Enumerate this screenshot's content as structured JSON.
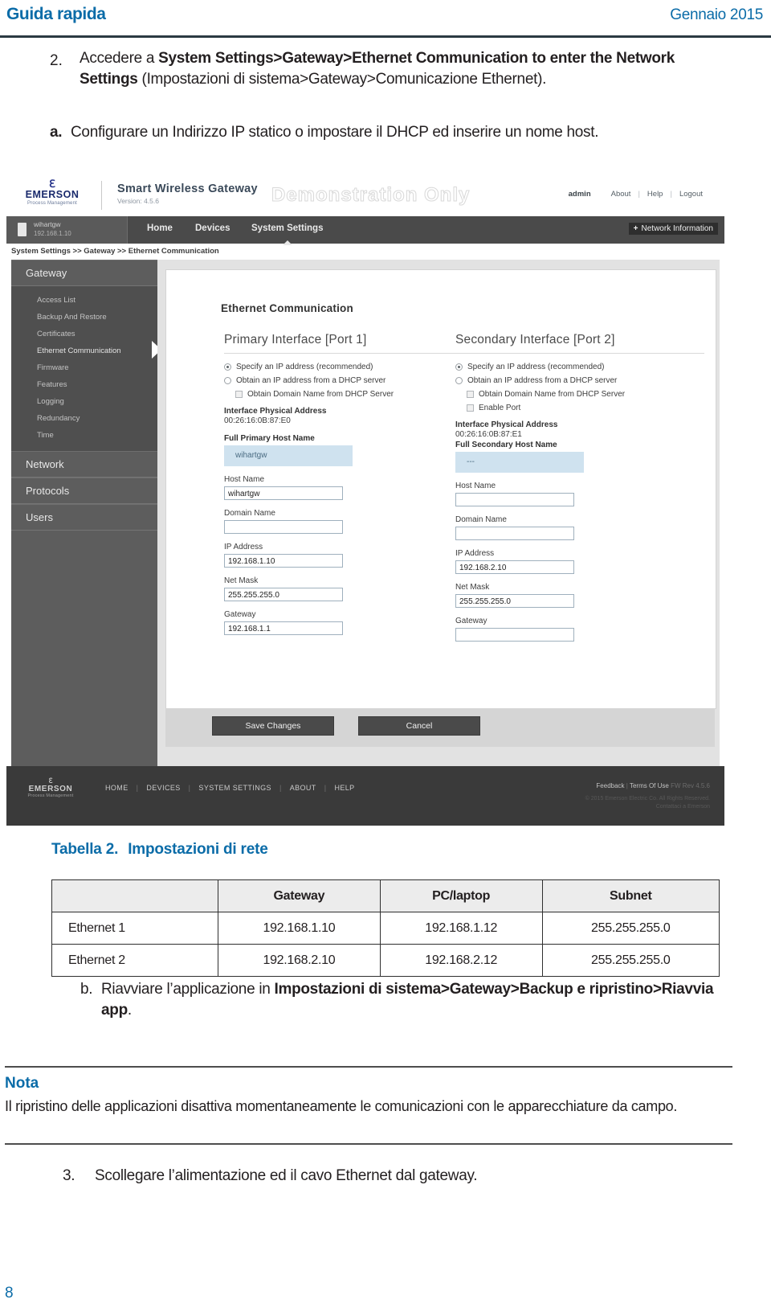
{
  "page": {
    "header_title": "Guida rapida",
    "header_date": "Gennaio 2015",
    "page_number": "8"
  },
  "step2": {
    "number": "2.",
    "text_part1": "Accedere a ",
    "bold1": "System Settings>Gateway>Ethernet Communication to enter the Network Settings",
    "text_part2": " (Impostazioni di sistema>Gateway>Comunicazione Ethernet).",
    "sub_a_label": "a.",
    "sub_a_text": "Configurare un Indirizzo IP statico o impostare il DHCP ed inserire un nome host."
  },
  "screenshot": {
    "brand": {
      "mark": "ℇ",
      "name": "EMERSON",
      "tagline": "Process Management"
    },
    "product": {
      "name": "Smart Wireless Gateway",
      "version": "Version: 4.5.6"
    },
    "watermark": "Demonstration Only",
    "topnav_right": {
      "user": "admin",
      "about": "About",
      "help": "Help",
      "logout": "Logout"
    },
    "device": {
      "name": "wihartgw",
      "ip": "192.168.1.10"
    },
    "nav": [
      "Home",
      "Devices",
      "System Settings"
    ],
    "nav_active": "System Settings",
    "network_information": "Network Information",
    "breadcrumb": "System Settings >> Gateway >> Ethernet Communication",
    "sidebar": {
      "sections": [
        {
          "label": "Gateway",
          "items": [
            "Access List",
            "Backup And Restore",
            "Certificates",
            "Ethernet Communication",
            "Firmware",
            "Features",
            "Logging",
            "Redundancy",
            "Time"
          ],
          "selected": "Ethernet Communication"
        },
        {
          "label": "Network",
          "items": []
        },
        {
          "label": "Protocols",
          "items": []
        },
        {
          "label": "Users",
          "items": []
        }
      ]
    },
    "panel_title": "Ethernet Communication",
    "primary": {
      "title": "Primary Interface [Port 1]",
      "radio_specify": "Specify an IP address (recommended)",
      "radio_dhcp": "Obtain an IP address from a DHCP server",
      "check_domain": "Obtain Domain Name from DHCP Server",
      "mac_label": "Interface Physical Address",
      "mac_value": "00:26:16:0B:87:E0",
      "full_host_label": "Full Primary Host Name",
      "full_host_value": "wihartgw",
      "host_label": "Host Name",
      "host_value": "wihartgw",
      "domain_label": "Domain Name",
      "domain_value": "",
      "ip_label": "IP Address",
      "ip_value": "192.168.1.10",
      "mask_label": "Net Mask",
      "mask_value": "255.255.255.0",
      "gateway_label": "Gateway",
      "gateway_value": "192.168.1.1"
    },
    "secondary": {
      "title": "Secondary Interface [Port 2]",
      "radio_specify": "Specify an IP address (recommended)",
      "radio_dhcp": "Obtain an IP address from a DHCP server",
      "check_domain": "Obtain Domain Name from DHCP Server",
      "check_enable_port": "Enable Port",
      "mac_label": "Interface Physical Address",
      "mac_value": "00:26:16:0B:87:E1",
      "full_host_label": "Full Secondary Host Name",
      "full_host_value": "---",
      "host_label": "Host Name",
      "host_value": "",
      "domain_label": "Domain Name",
      "domain_value": "",
      "ip_label": "IP Address",
      "ip_value": "192.168.2.10",
      "mask_label": "Net Mask",
      "mask_value": "255.255.255.0",
      "gateway_label": "Gateway",
      "gateway_value": ""
    },
    "buttons": {
      "save": "Save Changes",
      "cancel": "Cancel"
    },
    "footer": {
      "nav": [
        "HOME",
        "DEVICES",
        "SYSTEM SETTINGS",
        "ABOUT",
        "HELP"
      ],
      "feedback": "Feedback",
      "terms": "Terms Of Use",
      "fw": "FW Rev 4.5.6",
      "copyright_line1": "© 2015 Emerson Electric Co. All Rights Reserved.",
      "copyright_line2": "Contattaci a Emerson"
    }
  },
  "table": {
    "caption_number": "Tabella 2.",
    "caption_text": "Impostazioni di rete",
    "headers": [
      "",
      "Gateway",
      "PC/laptop",
      "Subnet"
    ],
    "rows": [
      [
        "Ethernet 1",
        "192.168.1.10",
        "192.168.1.12",
        "255.255.255.0"
      ],
      [
        "Ethernet 2",
        "192.168.2.10",
        "192.168.2.12",
        "255.255.255.0"
      ]
    ]
  },
  "step_b": {
    "label": "b.",
    "text_part1": "Riavviare l’applicazione in ",
    "bold": "Impostazioni di sistema>Gateway>Backup e ripristino>Riavvia app",
    "text_part2": "."
  },
  "note": {
    "title": "Nota",
    "body": "Il ripristino delle applicazioni disattiva momentaneamente le comunicazioni con le apparecchiature da campo."
  },
  "step3": {
    "number": "3.",
    "text": "Scollegare l’alimentazione ed il cavo Ethernet dal gateway."
  }
}
